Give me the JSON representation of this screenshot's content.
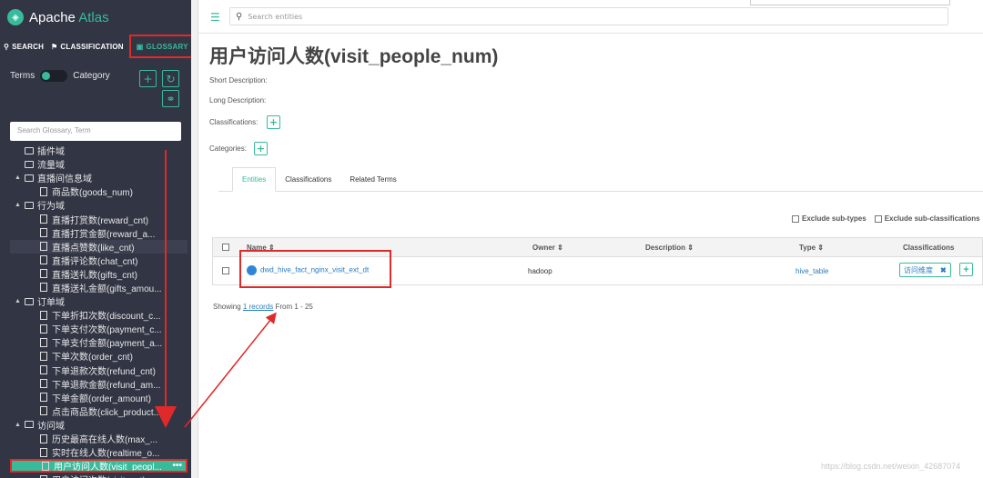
{
  "app": {
    "name_a": "Apache ",
    "name_b": "Atlas"
  },
  "nav": {
    "search": "SEARCH",
    "classification": "CLASSIFICATION",
    "glossary": "GLOSSARY"
  },
  "toggle": {
    "left": "Terms",
    "right": "Category"
  },
  "glossary_search": {
    "placeholder": "Search Glossary, Term"
  },
  "tree": [
    {
      "label": "插件域",
      "type": "folder",
      "level": 0,
      "expanded": false
    },
    {
      "label": "流量域",
      "type": "folder",
      "level": 0,
      "expanded": false
    },
    {
      "label": "直播间信息域",
      "type": "folder",
      "level": 0,
      "expanded": true
    },
    {
      "label": "商品数(goods_num)",
      "type": "file",
      "level": 1
    },
    {
      "label": "行为域",
      "type": "folder",
      "level": 0,
      "expanded": true
    },
    {
      "label": "直播打赏数(reward_cnt)",
      "type": "file",
      "level": 1
    },
    {
      "label": "直播打赏金额(reward_a...",
      "type": "file",
      "level": 1
    },
    {
      "label": "直播点赞数(like_cnt)",
      "type": "file",
      "level": 1,
      "state": "hover"
    },
    {
      "label": "直播评论数(chat_cnt)",
      "type": "file",
      "level": 1
    },
    {
      "label": "直播送礼数(gifts_cnt)",
      "type": "file",
      "level": 1
    },
    {
      "label": "直播送礼金额(gifts_amou...",
      "type": "file",
      "level": 1
    },
    {
      "label": "订单域",
      "type": "folder",
      "level": 0,
      "expanded": true
    },
    {
      "label": "下单折扣次数(discount_c...",
      "type": "file",
      "level": 1
    },
    {
      "label": "下单支付次数(payment_c...",
      "type": "file",
      "level": 1
    },
    {
      "label": "下单支付金额(payment_a...",
      "type": "file",
      "level": 1
    },
    {
      "label": "下单次数(order_cnt)",
      "type": "file",
      "level": 1
    },
    {
      "label": "下单退款次数(refund_cnt)",
      "type": "file",
      "level": 1
    },
    {
      "label": "下单退款金额(refund_am...",
      "type": "file",
      "level": 1
    },
    {
      "label": "下单金额(order_amount)",
      "type": "file",
      "level": 1
    },
    {
      "label": "点击商品数(click_product...",
      "type": "file",
      "level": 1
    },
    {
      "label": "访问域",
      "type": "folder",
      "level": 0,
      "expanded": true
    },
    {
      "label": "历史最高在线人数(max_...",
      "type": "file",
      "level": 1
    },
    {
      "label": "实时在线人数(realtime_o...",
      "type": "file",
      "level": 1
    },
    {
      "label": "用户访问人数(visit_peopl...",
      "type": "file",
      "level": 1,
      "state": "selected",
      "menu": "•••"
    },
    {
      "label": "用户访问次数(visit_cnt)",
      "type": "file",
      "level": 1
    }
  ],
  "topbar": {
    "search_placeholder": "Search entities"
  },
  "term": {
    "title": "用户访问人数(visit_people_num)",
    "short_desc_label": "Short Description:",
    "long_desc_label": "Long Description:",
    "classifications_label": "Classifications:",
    "categories_label": "Categories:"
  },
  "detail_tabs": [
    "Entities",
    "Classifications",
    "Related Terms"
  ],
  "filters": {
    "exclude_subtypes": "Exclude sub-types",
    "exclude_subclass": "Exclude sub-classifications"
  },
  "table": {
    "headers": {
      "name": "Name ⇕",
      "owner": "Owner ⇕",
      "description": "Description ⇕",
      "type": "Type ⇕",
      "classifications": "Classifications"
    },
    "rows": [
      {
        "name": "dwd_hive_fact_nginx_visit_ext_dt",
        "owner": "hadoop",
        "description": "",
        "type": "hive_table",
        "tag": "访问维度",
        "tag_remove": "✖"
      }
    ]
  },
  "pagination": {
    "prefix": "Showing ",
    "count": "1 records",
    "suffix": " From 1 - 25"
  },
  "watermark": "https://blog.csdn.net/weixin_42687074",
  "colors": {
    "accent": "#37bb9b",
    "sidebar": "#323544",
    "annotation": "#e02a2a",
    "link": "#2a7cc1"
  }
}
